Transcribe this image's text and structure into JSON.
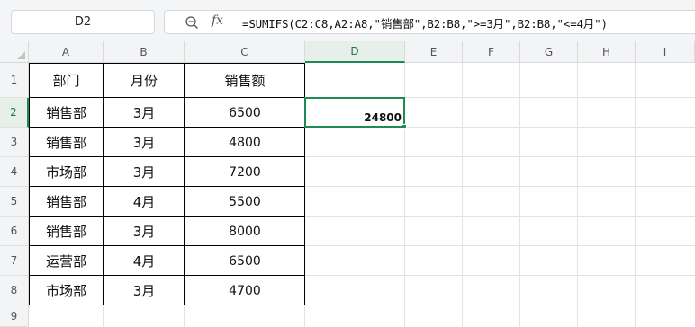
{
  "formula_bar": {
    "name_box": "D2",
    "fx_label": "fx",
    "formula": "=SUMIFS(C2:C8,A2:A8,\"销售部\",B2:B8,\">=3月\",B2:B8,\"<=4月\")"
  },
  "columns": [
    "A",
    "B",
    "C",
    "D",
    "E",
    "F",
    "G",
    "H",
    "I"
  ],
  "rows": [
    "1",
    "2",
    "3",
    "4",
    "5",
    "6",
    "7",
    "8",
    "9"
  ],
  "table": {
    "headers": [
      "部门",
      "月份",
      "销售额"
    ],
    "rows": [
      [
        "销售部",
        "3月",
        "6500"
      ],
      [
        "销售部",
        "3月",
        "4800"
      ],
      [
        "市场部",
        "3月",
        "7200"
      ],
      [
        "销售部",
        "4月",
        "5500"
      ],
      [
        "销售部",
        "3月",
        "8000"
      ],
      [
        "运营部",
        "4月",
        "6500"
      ],
      [
        "市场部",
        "3月",
        "4700"
      ]
    ]
  },
  "selection": {
    "cell": "D2",
    "value": "24800"
  },
  "colors": {
    "accent": "#1f8a55",
    "header_bg": "#f3f4f6",
    "gridline": "#e3e3e3"
  }
}
